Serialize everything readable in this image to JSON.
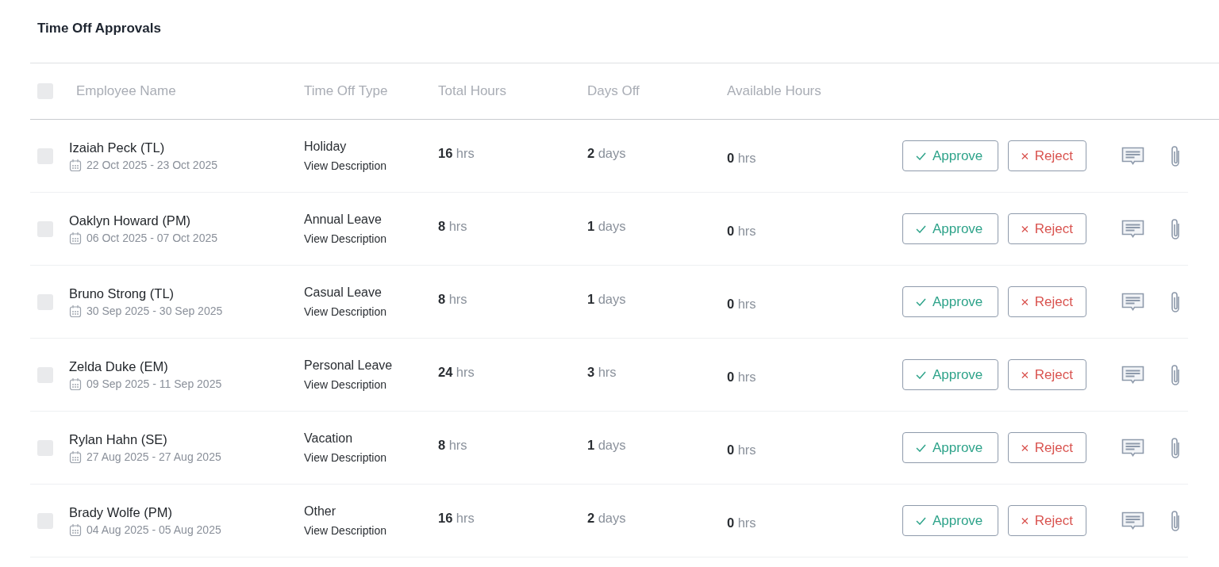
{
  "title": "Time Off Approvals",
  "header": {
    "checked": false,
    "columns": [
      "Employee Name",
      "Time Off Type",
      "Total Hours",
      "Days Off",
      "Available Hours"
    ]
  },
  "rows": [
    {
      "checked": false,
      "name": "Izaiah Peck (TL)",
      "dates": "22 Oct 2025 - 23 Oct 2025",
      "type": "Holiday",
      "link": "View Description",
      "total": {
        "value": "16",
        "unit": "hrs"
      },
      "days": {
        "value": "2",
        "unit": "days"
      },
      "available": {
        "value": "0",
        "unit": "hrs"
      },
      "approve": "Approve",
      "reject": "Reject"
    },
    {
      "checked": false,
      "name": "Oaklyn Howard (PM)",
      "dates": "06 Oct 2025 - 07 Oct 2025",
      "type": "Annual Leave",
      "link": "View Description",
      "total": {
        "value": "8",
        "unit": "hrs"
      },
      "days": {
        "value": "1",
        "unit": "days"
      },
      "available": {
        "value": "0",
        "unit": "hrs"
      },
      "approve": "Approve",
      "reject": "Reject"
    },
    {
      "checked": false,
      "name": "Bruno Strong (TL)",
      "dates": "30 Sep 2025 - 30 Sep 2025",
      "type": "Casual Leave",
      "link": "View Description",
      "total": {
        "value": "8",
        "unit": "hrs"
      },
      "days": {
        "value": "1",
        "unit": "days"
      },
      "available": {
        "value": "0",
        "unit": "hrs"
      },
      "approve": "Approve",
      "reject": "Reject"
    },
    {
      "checked": false,
      "name": "Zelda Duke (EM)",
      "dates": "09 Sep 2025 - 11 Sep 2025",
      "type": "Personal Leave",
      "link": "View Description",
      "total": {
        "value": "24",
        "unit": "hrs"
      },
      "days": {
        "value": "3",
        "unit": "hrs"
      },
      "available": {
        "value": "0",
        "unit": "hrs"
      },
      "approve": "Approve",
      "reject": "Reject"
    },
    {
      "checked": false,
      "name": "Rylan Hahn (SE)",
      "dates": "27 Aug 2025 - 27 Aug 2025",
      "type": "Vacation",
      "link": "View Description",
      "total": {
        "value": "8",
        "unit": "hrs"
      },
      "days": {
        "value": "1",
        "unit": "days"
      },
      "available": {
        "value": "0",
        "unit": "hrs"
      },
      "approve": "Approve",
      "reject": "Reject"
    },
    {
      "checked": false,
      "name": "Brady Wolfe (PM)",
      "dates": "04 Aug 2025 - 05 Aug 2025",
      "type": "Other",
      "link": "View Description",
      "total": {
        "value": "16",
        "unit": "hrs"
      },
      "days": {
        "value": "2",
        "unit": "days"
      },
      "available": {
        "value": "0",
        "unit": "hrs"
      },
      "approve": "Approve",
      "reject": "Reject"
    }
  ]
}
